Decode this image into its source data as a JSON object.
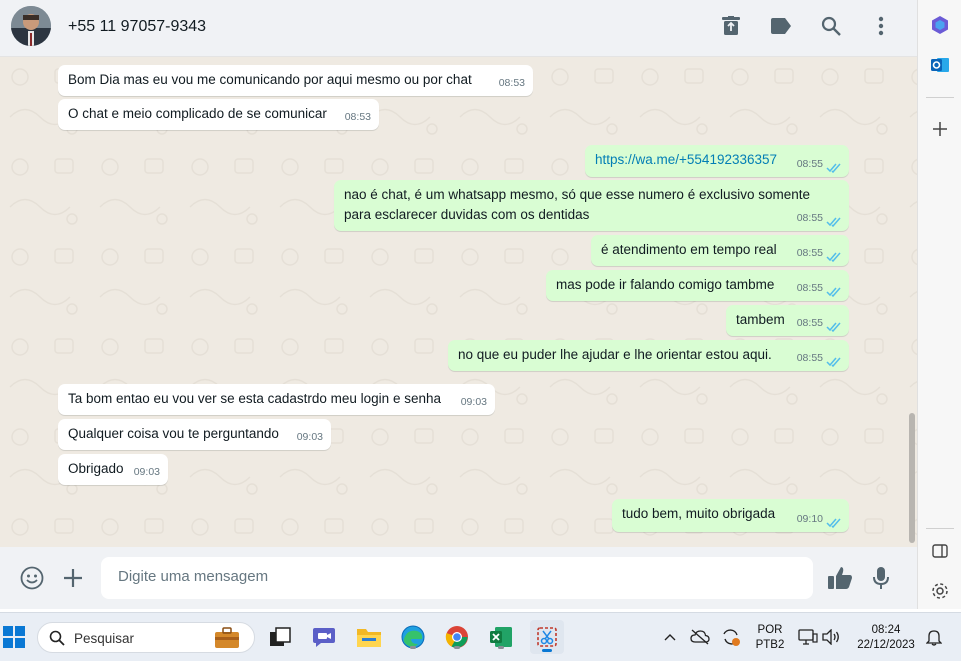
{
  "header": {
    "contact_name": "+55 11 97057-9343",
    "icons": [
      "archive-icon",
      "label-icon",
      "search-icon",
      "more-vertical-icon"
    ]
  },
  "messages": [
    {
      "dir": "in",
      "text": "Bom Dia mas eu vou me comunicando por aqui mesmo ou por chat",
      "time": "08:53"
    },
    {
      "dir": "in",
      "text": "O chat e meio complicado de se comunicar",
      "time": "08:53"
    },
    {
      "dir": "out",
      "text": "https://wa.me/+554192336357",
      "time": "08:55",
      "is_link": true
    },
    {
      "dir": "out",
      "text": "nao é chat, é um whatsapp mesmo, só que esse numero é exclusivo somente para esclarecer duvidas com os dentidas",
      "time": "08:55"
    },
    {
      "dir": "out",
      "text": "é atendimento em tempo real",
      "time": "08:55"
    },
    {
      "dir": "out",
      "text": "mas pode ir falando comigo tambme",
      "time": "08:55"
    },
    {
      "dir": "out",
      "text": "tambem",
      "time": "08:55"
    },
    {
      "dir": "out",
      "text": "no que eu puder lhe ajudar e lhe orientar estou aqui.",
      "time": "08:55"
    },
    {
      "dir": "in",
      "text": "Ta bom entao eu vou ver se esta cadastrdo meu login e senha",
      "time": "09:03"
    },
    {
      "dir": "in",
      "text": "Qualquer coisa vou te perguntando",
      "time": "09:03"
    },
    {
      "dir": "in",
      "text": "Obrigado",
      "time": "09:03"
    },
    {
      "dir": "out",
      "text": "tudo bem, muito obrigada",
      "time": "09:10"
    }
  ],
  "composer": {
    "placeholder": "Digite uma mensagem"
  },
  "taskbar": {
    "search_label": "Pesquisar",
    "language_top": "POR",
    "language_bottom": "PTB2",
    "time": "08:24",
    "date": "22/12/2023"
  },
  "colors": {
    "chat_bg": "#efeae2",
    "incoming": "#ffffff",
    "outgoing": "#d9fdd3",
    "tick_read": "#53bdeb",
    "link": "#027eb5"
  }
}
